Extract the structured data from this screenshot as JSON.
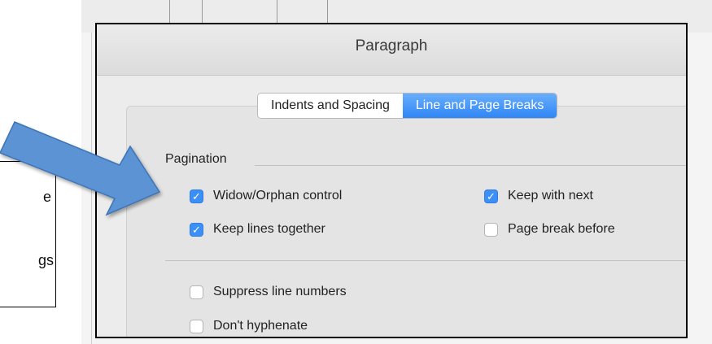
{
  "dialog": {
    "title": "Paragraph",
    "tabs": [
      {
        "label": "Indents and Spacing",
        "active": false
      },
      {
        "label": "Line and Page Breaks",
        "active": true
      }
    ],
    "pagination": {
      "label": "Pagination",
      "options": [
        {
          "label": "Widow/Orphan control",
          "checked": true
        },
        {
          "label": "Keep with next",
          "checked": true
        },
        {
          "label": "Keep lines together",
          "checked": true
        },
        {
          "label": "Page break before",
          "checked": false
        }
      ]
    },
    "other_options": [
      {
        "label": "Suppress line numbers",
        "checked": false
      },
      {
        "label": "Don't hyphenate",
        "checked": false
      }
    ]
  },
  "callout": {
    "lines": [
      "e",
      "gs"
    ]
  },
  "colors": {
    "accent": "#3b8ff6",
    "arrow": "#5b93d4"
  },
  "icons": {
    "check": "✓",
    "arrow": "pointer-arrow-icon"
  }
}
